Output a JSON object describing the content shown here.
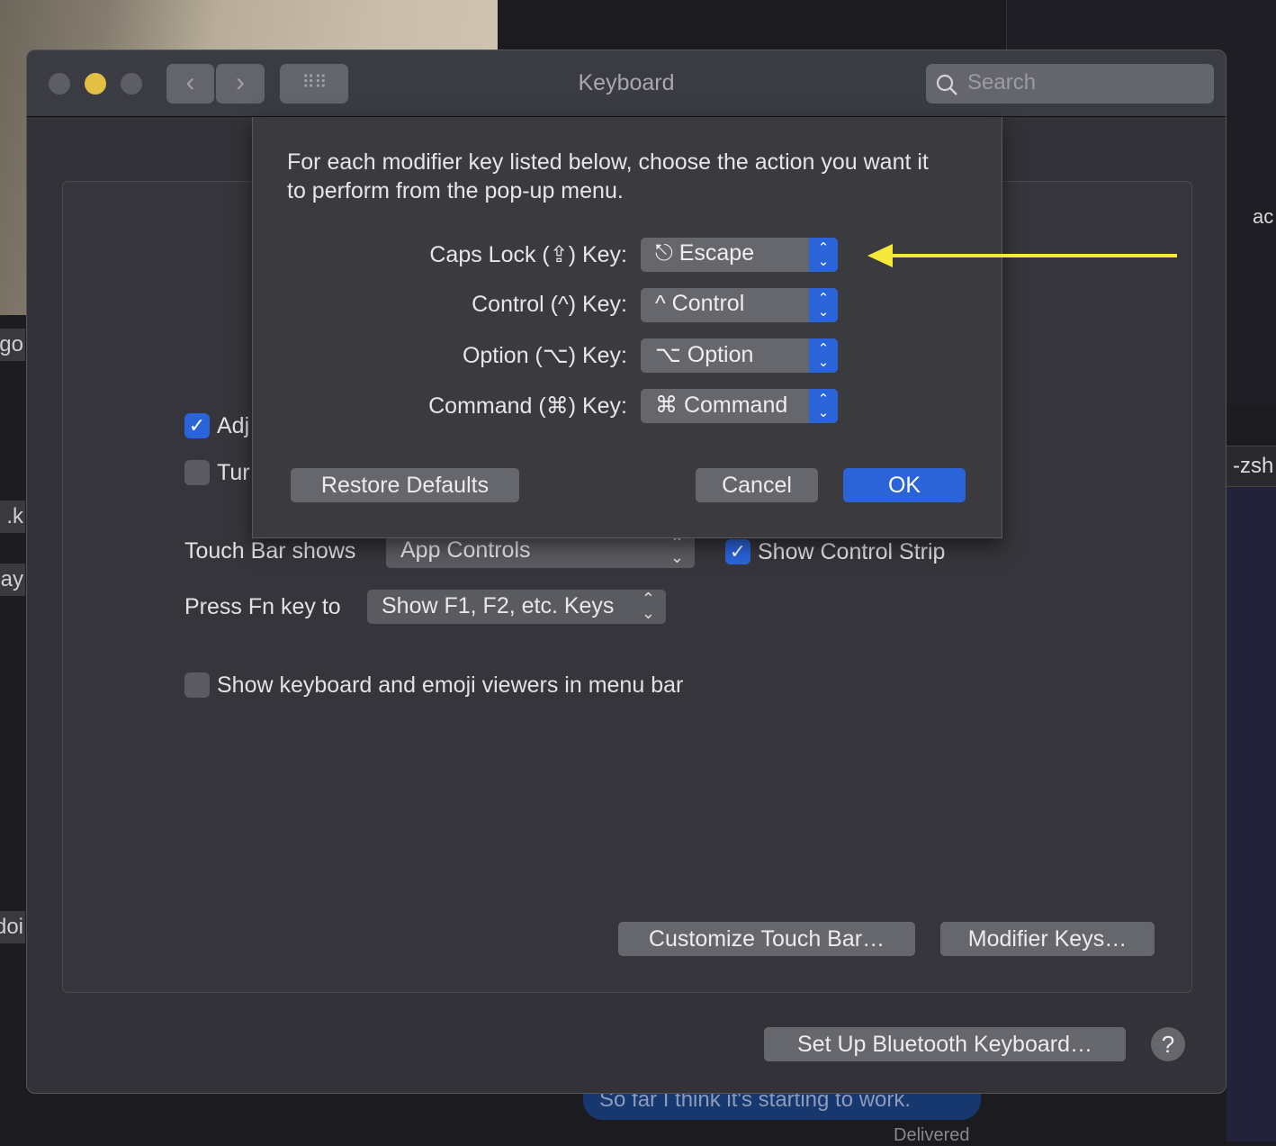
{
  "window": {
    "title": "Keyboard",
    "search_placeholder": "Search",
    "nav_back_icon": "chevron-left-icon",
    "nav_forward_icon": "chevron-right-icon",
    "grid_icon": "grid-icon"
  },
  "background": {
    "left_bubbles": [
      "go",
      "k.",
      "ay",
      "doi"
    ],
    "right_text": "ac",
    "terminal_tab": "-zsh",
    "message": "So far I think it's starting to work.",
    "message_status": "Delivered"
  },
  "settings": {
    "checkbox_adjust": {
      "label": "Adj",
      "checked": true
    },
    "checkbox_turn": {
      "label": "Tur",
      "checked": false
    },
    "touch_bar_label": "Touch Bar shows",
    "touch_bar_value": "App Controls",
    "show_control_strip": {
      "label": "Show Control Strip",
      "checked": true
    },
    "fn_label": "Press Fn key to",
    "fn_value": "Show F1, F2, etc. Keys",
    "show_viewers": {
      "label": "Show keyboard and emoji viewers in menu bar",
      "checked": false
    },
    "customize_touch_bar": "Customize Touch Bar…",
    "modifier_keys": "Modifier Keys…",
    "bluetooth": "Set Up Bluetooth Keyboard…",
    "help": "?"
  },
  "sheet": {
    "description": "For each modifier key listed below, choose the action you want it to perform from the pop-up menu.",
    "rows": [
      {
        "label": "Caps Lock (⇪) Key:",
        "value": "⎋ Escape"
      },
      {
        "label": "Control (^) Key:",
        "value": "^ Control"
      },
      {
        "label": "Option (⌥) Key:",
        "value": "⌥ Option"
      },
      {
        "label": "Command (⌘) Key:",
        "value": "⌘ Command"
      }
    ],
    "restore_defaults": "Restore Defaults",
    "cancel": "Cancel",
    "ok": "OK"
  },
  "annotation": {
    "arrow_color": "#f5ea3a"
  },
  "colors": {
    "accent": "#2a64d8",
    "minimize": "#e3c043"
  }
}
